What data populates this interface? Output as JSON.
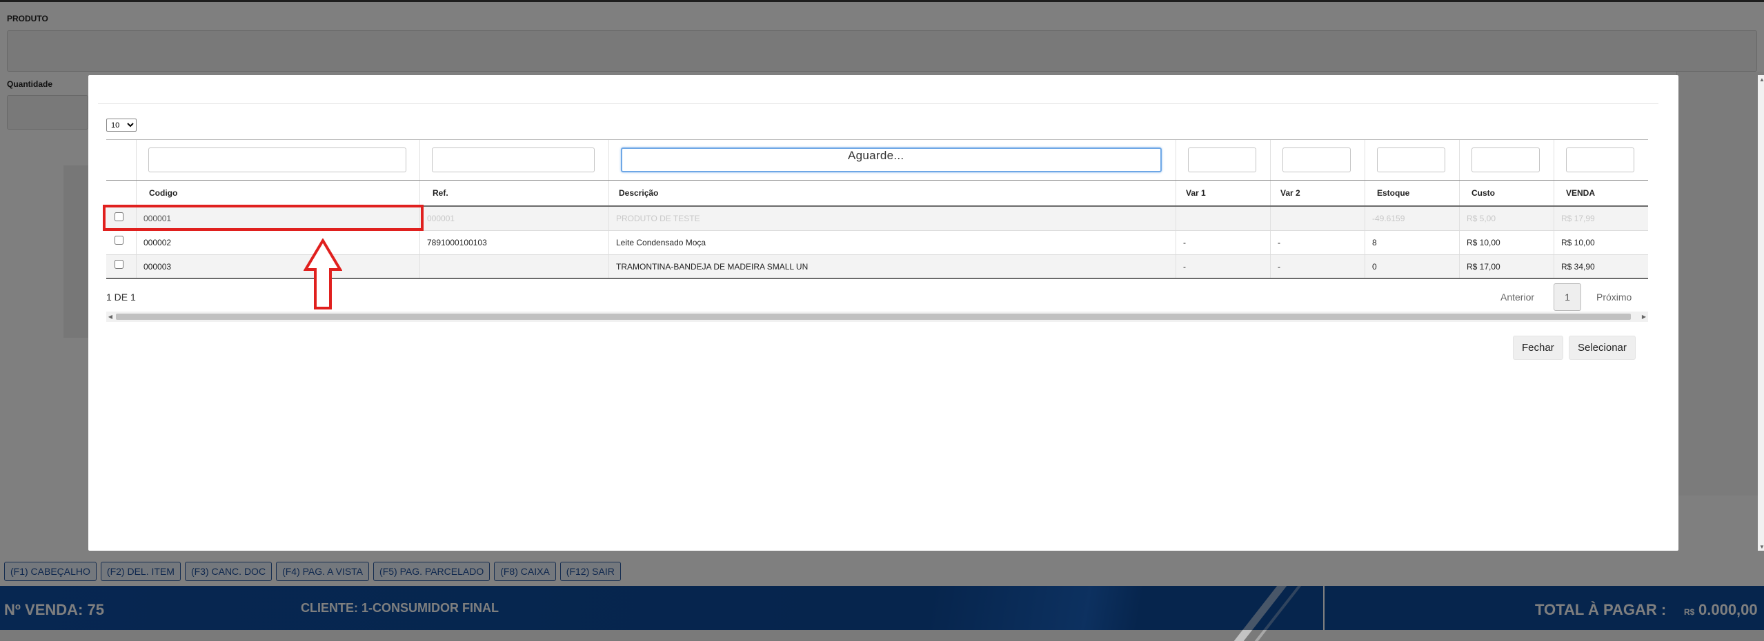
{
  "background": {
    "produto_label": "PRODUTO",
    "quantidade_label": "Quantidade",
    "function_keys": [
      "(F1) CABEÇALHO",
      "(F2) DEL. ITEM",
      "(F3) CANC. DOC",
      "(F4) PAG. A VISTA",
      "(F5) PAG. PARCELADO",
      "(F8) CAIXA",
      "(F12) SAIR"
    ],
    "footer": {
      "venda_label": "Nº VENDA: 75",
      "cliente_label": "CLIENTE: 1-CONSUMIDOR FINAL",
      "total_label": "TOTAL À PAGAR :",
      "total_currency": "R$",
      "total_value": "0.000,00"
    }
  },
  "modal": {
    "page_size": "10",
    "loading_text": "Aguarde...",
    "columns": [
      "Codigo",
      "Ref.",
      "Descrição",
      "Var 1",
      "Var 2",
      "Estoque",
      "Custo",
      "VENDA"
    ],
    "rows": [
      {
        "codigo": "000001",
        "ref": "000001",
        "descricao": "PRODUTO DE TESTE",
        "var1": "",
        "var2": "",
        "estoque": "-49.6159",
        "custo": "R$ 5,00",
        "venda": "R$ 17,99"
      },
      {
        "codigo": "000002",
        "ref": "7891000100103",
        "descricao": "Leite Condensado Moça",
        "var1": "-",
        "var2": "-",
        "estoque": "8",
        "custo": "R$ 10,00",
        "venda": "R$ 10,00"
      },
      {
        "codigo": "000003",
        "ref": "",
        "descricao": "TRAMONTINA-BANDEJA DE MADEIRA SMALL UN",
        "var1": "-",
        "var2": "-",
        "estoque": "0",
        "custo": "R$ 17,00",
        "venda": "R$ 34,90"
      }
    ],
    "pagination": {
      "info": "1 DE 1",
      "prev": "Anterior",
      "current": "1",
      "next": "Próximo"
    },
    "buttons": {
      "close": "Fechar",
      "select": "Selecionar"
    }
  },
  "colors": {
    "highlight": "#e0201e",
    "footer_blue": "#0d4a9a",
    "fkey_border": "#2c5aa0"
  }
}
